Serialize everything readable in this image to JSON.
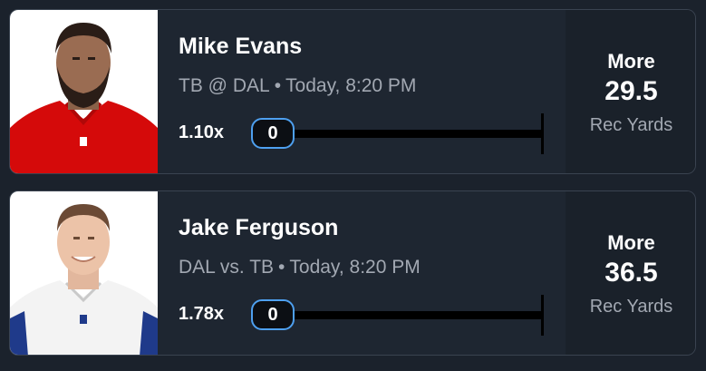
{
  "picks": [
    {
      "player": "Mike Evans",
      "matchup": "TB @ DAL",
      "time": "Today, 8:20 PM",
      "multiplier": "1.10x",
      "pick_count": "0",
      "pick_label": "More",
      "line": "29.5",
      "stat": "Rec Yards",
      "jersey_color": "#d50a0a"
    },
    {
      "player": "Jake Ferguson",
      "matchup": "DAL vs. TB",
      "time": "Today, 8:20 PM",
      "multiplier": "1.78x",
      "pick_count": "0",
      "pick_label": "More",
      "line": "36.5",
      "stat": "Rec Yards",
      "jersey_color": "#f5f5f5"
    }
  ],
  "separator": "•",
  "colors": {
    "background": "#1b222c",
    "card": "#1e2631",
    "accent_blue": "#4ea0f0"
  }
}
